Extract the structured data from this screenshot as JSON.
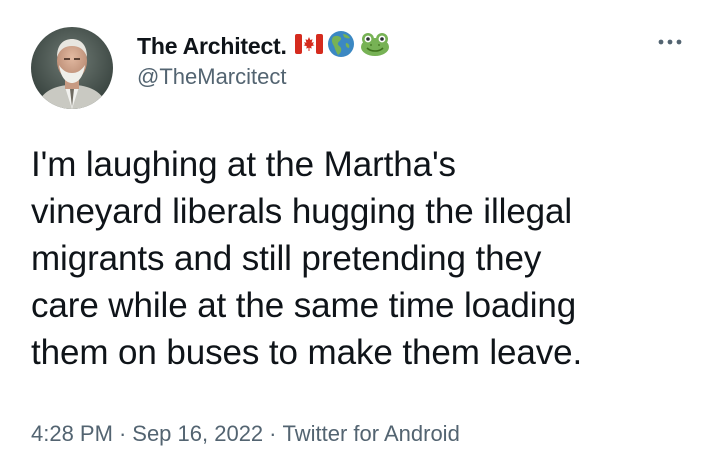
{
  "author": {
    "display_name": "The Architect.",
    "handle": "@TheMarcitect",
    "emojis": [
      "canada-flag-icon",
      "globe-americas-icon",
      "frog-icon"
    ]
  },
  "tweet": {
    "text": "I'm laughing at the Martha's\nvineyard liberals hugging the illegal\nmigrants and still pretending they\ncare while at the same time loading\nthem on buses to make them leave."
  },
  "meta": {
    "time": "4:28 PM",
    "separator": "·",
    "date": "Sep 16, 2022",
    "source": "Twitter for Android"
  },
  "colors": {
    "text": "#0f1419",
    "secondary": "#536471"
  }
}
